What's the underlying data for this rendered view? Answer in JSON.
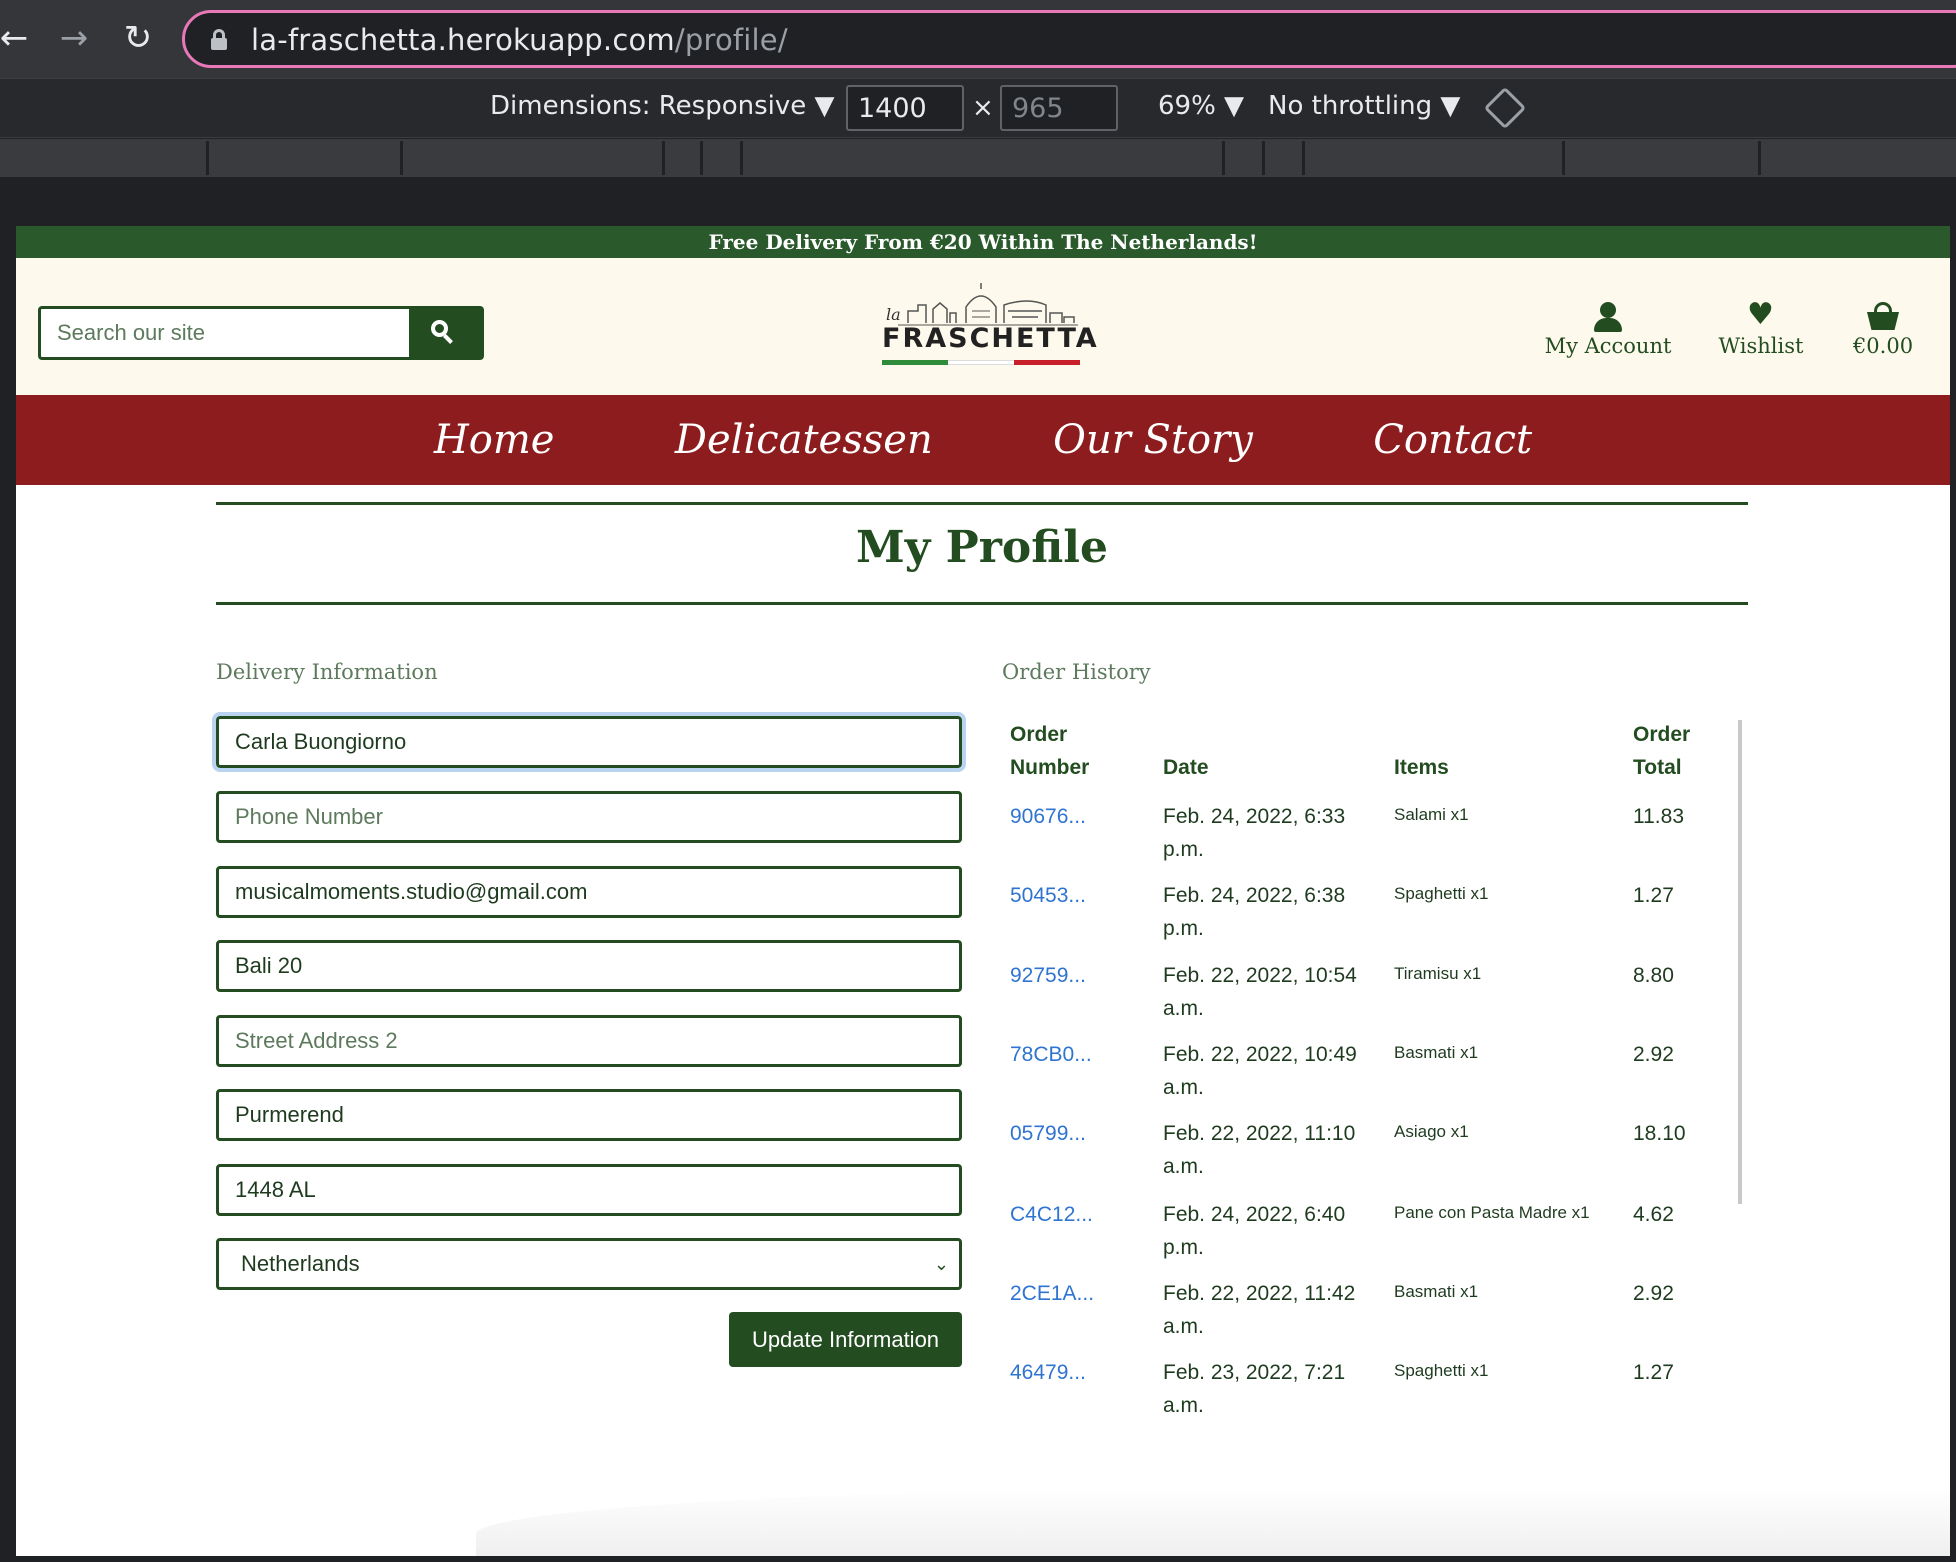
{
  "browser": {
    "url_host": "la-fraschetta.herokuapp.com",
    "url_path": "/profile/",
    "back_icon": "arrow-left-icon",
    "forward_icon": "arrow-right-icon",
    "reload_icon": "reload-icon"
  },
  "devtools": {
    "dimensions_label": "Dimensions: Responsive ▼",
    "width": "1400",
    "times": "×",
    "height": "965",
    "zoom": "69% ▼",
    "throttling": "No throttling ▼"
  },
  "site": {
    "banner": "Free Delivery From €20 Within The Netherlands!",
    "search_placeholder": "Search our site",
    "logo_small": "la",
    "logo_word": "FRASCHETTA",
    "account_label": "My Account",
    "wishlist_label": "Wishlist",
    "basket_total": "€0.00",
    "nav": [
      "Home",
      "Delicatessen",
      "Our Story",
      "Contact"
    ],
    "colors": {
      "green": "#234d20",
      "red": "#8c1c1d",
      "cream": "#fdf9ec"
    }
  },
  "profile": {
    "title": "My Profile",
    "delivery_label": "Delivery Information",
    "order_history_label": "Order History",
    "fields": {
      "full_name": "Carla Buongiorno",
      "phone_placeholder": "Phone Number",
      "email": "musicalmoments.studio@gmail.com",
      "street1": "Bali 20",
      "street2_placeholder": "Street Address 2",
      "town": "Purmerend",
      "postcode": "1448 AL",
      "country": "Netherlands"
    },
    "update_button": "Update Information"
  },
  "orders": {
    "headers": {
      "number_1": "Order",
      "number_2": "Number",
      "date": "Date",
      "items": "Items",
      "total_1": "Order",
      "total_2": "Total"
    },
    "rows": [
      {
        "number": "90676...",
        "date_1": "Feb. 24, 2022, 6:33",
        "date_2": "p.m.",
        "items": "Salami x1",
        "total": "11.83"
      },
      {
        "number": "50453...",
        "date_1": "Feb. 24, 2022, 6:38",
        "date_2": "p.m.",
        "items": "Spaghetti x1",
        "total": "1.27"
      },
      {
        "number": "92759...",
        "date_1": "Feb. 22, 2022, 10:54",
        "date_2": "a.m.",
        "items": "Tiramisu x1",
        "total": "8.80"
      },
      {
        "number": "78CB0...",
        "date_1": "Feb. 22, 2022, 10:49",
        "date_2": "a.m.",
        "items": "Basmati x1",
        "total": "2.92"
      },
      {
        "number": "05799...",
        "date_1": "Feb. 22, 2022, 11:10",
        "date_2": "a.m.",
        "items": "Asiago x1",
        "total": "18.10"
      },
      {
        "number": "C4C12...",
        "date_1": "Feb. 24, 2022, 6:40",
        "date_2": "p.m.",
        "items": "Pane con Pasta Madre x1",
        "total": "4.62"
      },
      {
        "number": "2CE1A...",
        "date_1": "Feb. 22, 2022, 11:42",
        "date_2": "a.m.",
        "items": "Basmati x1",
        "total": "2.92"
      },
      {
        "number": "46479...",
        "date_1": "Feb. 23, 2022, 7:21",
        "date_2": "a.m.",
        "items": "Spaghetti x1",
        "total": "1.27"
      }
    ]
  }
}
